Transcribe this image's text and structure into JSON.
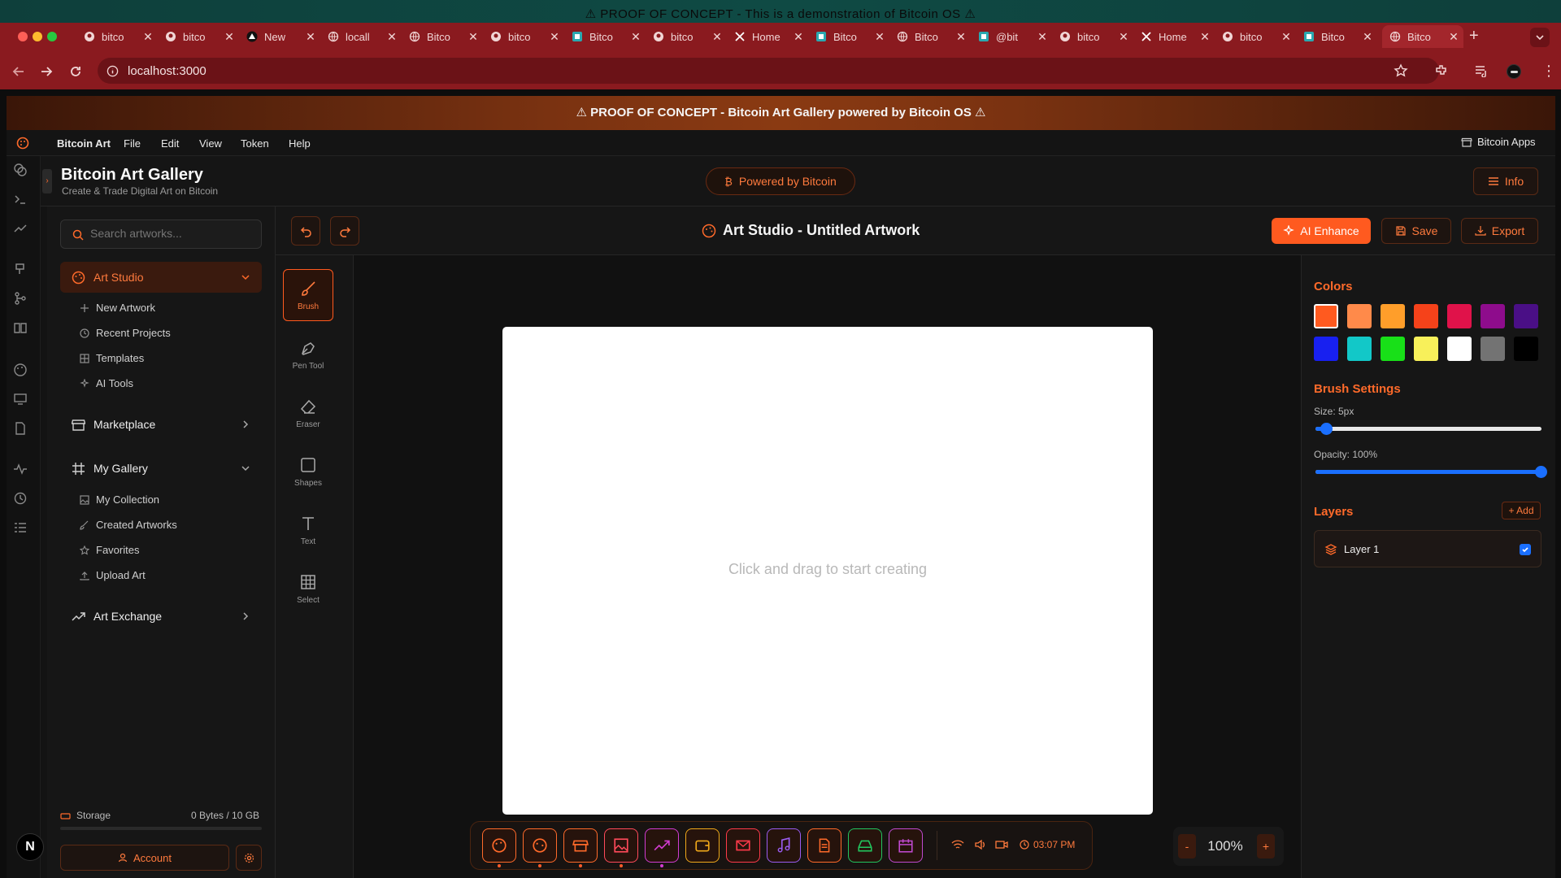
{
  "os_banner": "⚠ PROOF OF CONCEPT - This is a demonstration of Bitcoin OS ⚠",
  "tabs": [
    {
      "label": "bitco",
      "icon": "github-icon"
    },
    {
      "label": "bitco",
      "icon": "github-icon"
    },
    {
      "label": "New",
      "icon": "triangle-icon"
    },
    {
      "label": "locall",
      "icon": "globe-icon"
    },
    {
      "label": "Bitco",
      "icon": "globe-icon"
    },
    {
      "label": "bitco",
      "icon": "github-icon"
    },
    {
      "label": "Bitco",
      "icon": "app-icon"
    },
    {
      "label": "bitco",
      "icon": "github-icon"
    },
    {
      "label": "Home",
      "icon": "x-icon"
    },
    {
      "label": "Bitco",
      "icon": "app-icon"
    },
    {
      "label": "Bitco",
      "icon": "globe-icon"
    },
    {
      "label": "@bit",
      "icon": "app-icon"
    },
    {
      "label": "bitco",
      "icon": "github-icon"
    },
    {
      "label": "Home",
      "icon": "x-icon"
    },
    {
      "label": "bitco",
      "icon": "github-icon"
    },
    {
      "label": "Bitco",
      "icon": "app-icon"
    },
    {
      "label": "Bitco",
      "icon": "globe-icon"
    }
  ],
  "url": "localhost:3000",
  "poc_banner": "⚠ PROOF OF CONCEPT - Bitcoin Art Gallery powered by Bitcoin OS ⚠",
  "menubar": {
    "items": [
      "Bitcoin Art",
      "File",
      "Edit",
      "View",
      "Token",
      "Help"
    ],
    "apps": "Bitcoin Apps"
  },
  "header": {
    "title": "Bitcoin Art Gallery",
    "subtitle": "Create & Trade Digital Art on Bitcoin",
    "powered": "Powered by Bitcoin",
    "info": "Info"
  },
  "sidebar": {
    "search_placeholder": "Search artworks...",
    "art_studio": "Art Studio",
    "art_studio_items": [
      "New Artwork",
      "Recent Projects",
      "Templates",
      "AI Tools"
    ],
    "marketplace": "Marketplace",
    "my_gallery": "My Gallery",
    "gallery_items": [
      "My Collection",
      "Created Artworks",
      "Favorites",
      "Upload Art"
    ],
    "art_exchange": "Art Exchange",
    "storage_label": "Storage",
    "storage_value": "0 Bytes / 10 GB",
    "account": "Account"
  },
  "toolbar": {
    "title": "Art Studio - Untitled Artwork",
    "ai_enhance": "AI Enhance",
    "save": "Save",
    "export": "Export"
  },
  "tools": [
    "Brush",
    "Pen Tool",
    "Eraser",
    "Shapes",
    "Text",
    "Select"
  ],
  "canvas": {
    "hint": "Click and drag to start creating"
  },
  "right_panel": {
    "colors_title": "Colors",
    "colors": [
      "#ff5a1f",
      "#ff8a4a",
      "#ff9e2a",
      "#f5421a",
      "#e0124a",
      "#8e0c8c",
      "#4a0f86",
      "#1820f0",
      "#12c8c8",
      "#18e018",
      "#f8f05a",
      "#ffffff",
      "#737373",
      "#000000"
    ],
    "brush_title": "Brush Settings",
    "size_label": "Size: 5px",
    "size_fraction": 0.05,
    "opacity_label": "Opacity: 100%",
    "opacity_fraction": 1.0,
    "layers_title": "Layers",
    "add_label": "+ Add",
    "layer": "Layer 1"
  },
  "dock": {
    "apps": [
      {
        "name": "art-app",
        "color": "#ff6a2a"
      },
      {
        "name": "paint-app",
        "color": "#ff6a2a"
      },
      {
        "name": "store-app",
        "color": "#ff6a2a"
      },
      {
        "name": "image-app",
        "color": "#ff4a5a"
      },
      {
        "name": "exchange-app",
        "color": "#d23cd2"
      },
      {
        "name": "wallet-app",
        "color": "#f0a81a"
      },
      {
        "name": "mail-app",
        "color": "#ff3a4a"
      },
      {
        "name": "music-app",
        "color": "#9a5cf0"
      },
      {
        "name": "docs-app",
        "color": "#ff6a2a"
      },
      {
        "name": "drive-app",
        "color": "#22c55e"
      },
      {
        "name": "calendar-app",
        "color": "#c04ad0"
      }
    ],
    "time": "03:07 PM"
  },
  "zoom": {
    "minus": "-",
    "value": "100%",
    "plus": "+"
  },
  "avatar_letter": "N"
}
